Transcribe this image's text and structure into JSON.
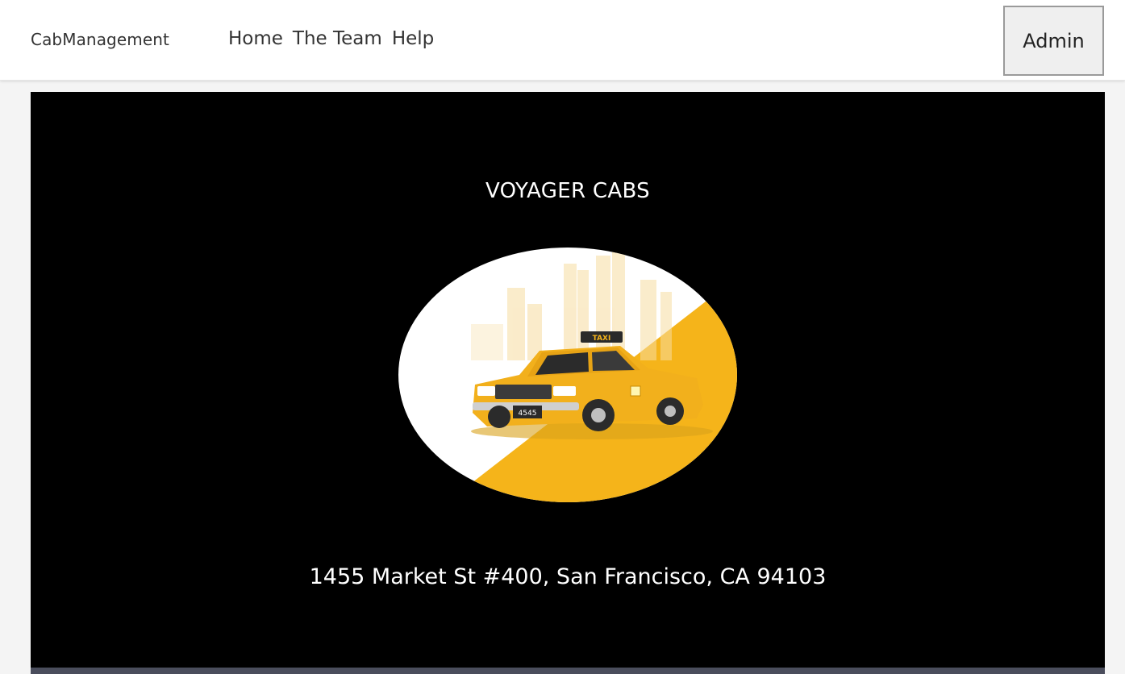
{
  "navbar": {
    "brand": "CabManagement",
    "links": [
      "Home",
      "The Team",
      "Help"
    ],
    "admin_label": "Admin"
  },
  "hero": {
    "title": "VOYAGER CABS",
    "address": "1455 Market St #400, San Francisco, CA 94103",
    "logo": {
      "roof_sign": "TAXI",
      "plate": "4545"
    }
  },
  "colors": {
    "hero_background": "#000000",
    "taxi_yellow": "#f5b41a",
    "navbar_background": "#ffffff"
  }
}
